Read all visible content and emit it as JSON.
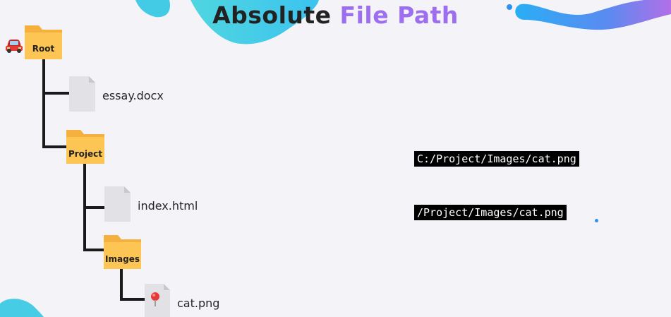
{
  "title": {
    "part1": "Absolute",
    "part2": "File Path"
  },
  "tree": {
    "root": {
      "label": "Root",
      "marker_icon": "car-icon"
    },
    "children": [
      {
        "type": "file",
        "label": "essay.docx"
      },
      {
        "type": "folder",
        "label": "Project"
      },
      {
        "type": "file",
        "label": "index.html"
      },
      {
        "type": "folder",
        "label": "Images"
      },
      {
        "type": "file",
        "label": "cat.png",
        "marker_icon": "pushpin-icon"
      }
    ]
  },
  "paths": {
    "windows_path": "C:/Project/Images/cat.png",
    "unix_path": "/Project/Images/cat.png"
  },
  "colors": {
    "title_accent": "#9d6ff0",
    "folder": "#fdc654",
    "tree_line": "#1a1a1a",
    "deco_cyan": "#48cfe3",
    "deco_blue": "#2aa9f0"
  }
}
